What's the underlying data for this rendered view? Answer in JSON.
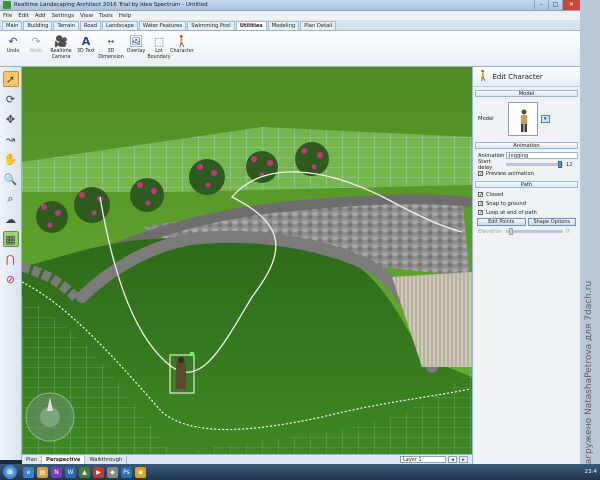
{
  "window": {
    "title": "Realtime Landscaping Architect 2016 Trial by Idea Spectrum - Untitled",
    "min": "–",
    "max": "□",
    "close": "✕"
  },
  "menu": [
    "File",
    "Edit",
    "Add",
    "Settings",
    "View",
    "Tools",
    "Help"
  ],
  "tabs": [
    {
      "label": "Main",
      "active": false
    },
    {
      "label": "Building",
      "active": false
    },
    {
      "label": "Terrain",
      "active": false
    },
    {
      "label": "Road",
      "active": false
    },
    {
      "label": "Landscape",
      "active": false
    },
    {
      "label": "Water Features",
      "active": false
    },
    {
      "label": "Swimming Pool",
      "active": false
    },
    {
      "label": "Utilities",
      "active": true
    },
    {
      "label": "Modeling",
      "active": false
    },
    {
      "label": "Plan Detail",
      "active": false
    }
  ],
  "ribbon": {
    "undo": "Undo",
    "redo": "Redo",
    "camera": "Realtime Camera",
    "text3d": "3D Text",
    "dimension": "3D Dimension",
    "overlay": "Overlay",
    "lot": "Lot Boundary",
    "character": "Character"
  },
  "panel": {
    "title": "Edit Character",
    "model_section": "Model",
    "model_label": "Model",
    "animation_section": "Animation",
    "animation_label": "Animation",
    "animation_value": "Jogging",
    "start_delay_label": "Start delay",
    "start_delay_value": "12",
    "start_delay_fraction": 0.92,
    "preview_label": "Preview animation",
    "path_section": "Path",
    "closed_label": "Closed",
    "snap_label": "Snap to ground",
    "loop_label": "Loop at end of path",
    "edit_points": "Edit Points",
    "shape_options": "Shape Options",
    "elevation_label": "Elevation",
    "elevation_value": "0'",
    "elevation_fraction": 0.05
  },
  "view_tabs": [
    {
      "label": "Plan",
      "active": false
    },
    {
      "label": "Perspective",
      "active": true
    },
    {
      "label": "Walkthrough",
      "active": false
    }
  ],
  "layer": {
    "value": "Layer 1",
    "prev": "◂",
    "next": "▸"
  },
  "clock": "23:4",
  "watermark": "Загружено NatashaPetrova для 7dach.ru",
  "colors": {
    "grass_light": "#5fa12e",
    "grass_dark": "#2f6a1c",
    "stone": "#8b8b8b",
    "flowers": "#c2397a",
    "grid": "#bfe8ff"
  }
}
